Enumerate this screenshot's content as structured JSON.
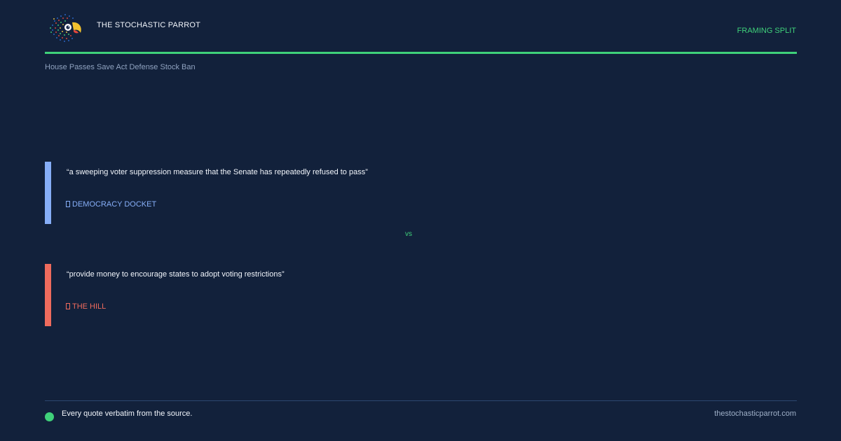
{
  "header": {
    "brand_name": "THE STOCHASTIC PARROT",
    "section_label": "FRAMING SPLIT",
    "headline": "House Passes Save Act Defense Stock Ban",
    "logo_icon": "parrot-logo-icon"
  },
  "accent_color": "#3fd17a",
  "quotes": [
    {
      "text": "“a sweeping voter suppression measure that the Senate has repeatedly refused to pass”",
      "source": "DEMOCRACY DOCKET",
      "color": "#86aef7",
      "icon": "source-icon"
    },
    {
      "text": "“provide money to encourage states to adopt voting restrictions”",
      "source": "THE HILL",
      "color": "#ef6b5d",
      "icon": "source-icon"
    }
  ],
  "separator": "vs",
  "footer": {
    "note": "Every quote verbatim from the source.",
    "site": "thestochasticparrot.com"
  }
}
